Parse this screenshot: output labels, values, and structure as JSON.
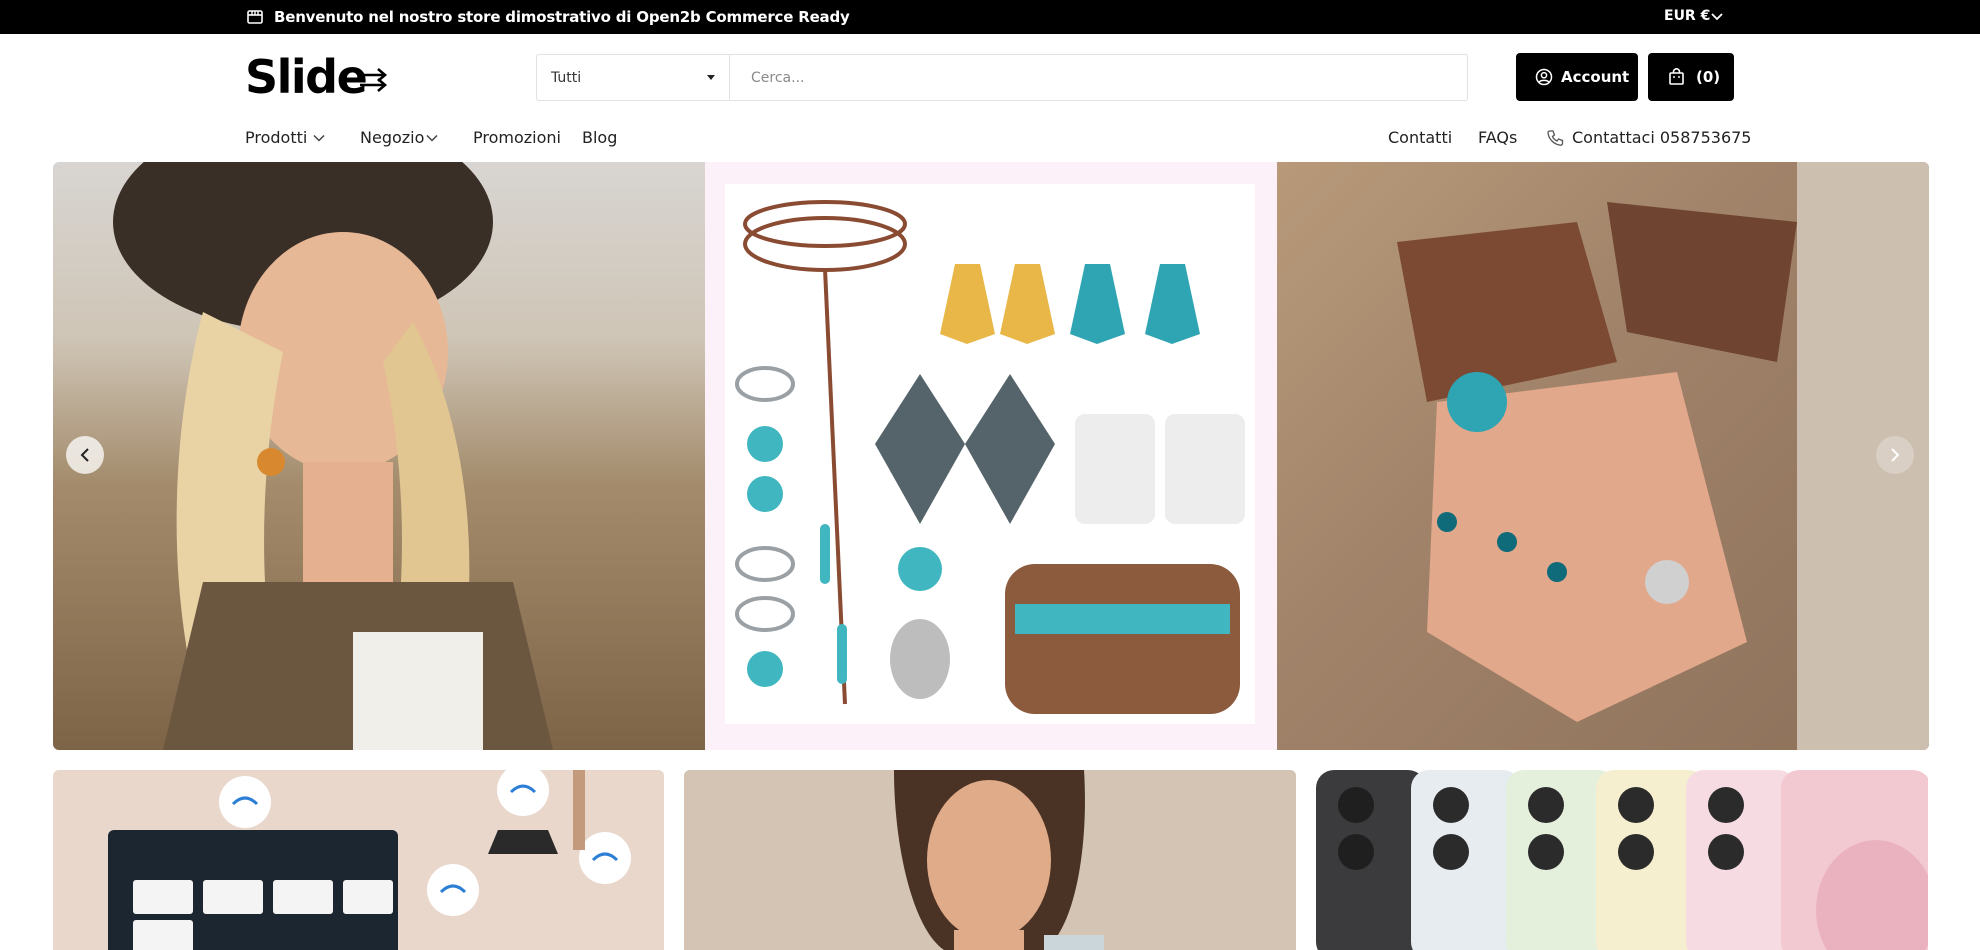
{
  "topbar": {
    "announcement": "Benvenuto nel nostro store dimostrativo di Open2b Commerce Ready",
    "currency": "EUR €"
  },
  "header": {
    "logo": "Slide",
    "category_select": "Tutti",
    "search_placeholder": "Cerca...",
    "account_label": "Account",
    "cart_label": "(0)"
  },
  "nav": {
    "left": [
      {
        "label": "Prodotti"
      },
      {
        "label": "Negozio"
      },
      {
        "label": "Promozioni"
      },
      {
        "label": "Blog"
      }
    ],
    "right": [
      {
        "label": "Contatti"
      },
      {
        "label": "FAQs"
      },
      {
        "label": "Contattaci 058753675"
      }
    ]
  },
  "colors": {
    "topbar_bg": "#000000",
    "button_bg": "#000000",
    "mid_panel_bg": "#fcf1f8"
  },
  "icons": {
    "store": "store-icon",
    "currency_chevron": "chevron-down-icon",
    "account": "user-circle-icon",
    "cart": "shopping-bag-icon",
    "phone": "phone-icon",
    "prev": "chevron-left-icon",
    "next": "chevron-right-icon"
  }
}
